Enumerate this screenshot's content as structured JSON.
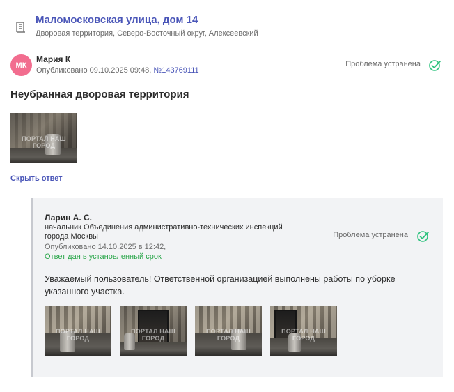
{
  "address": {
    "icon": "building-icon",
    "title": "Маломосковская улица, дом 14",
    "subtitle": "Дворовая территория, Северо-Восточный округ, Алексеевский"
  },
  "post": {
    "avatar_initials": "МК",
    "author": "Мария К",
    "published_prefix": "Опубликовано 09.10.2025 09:48, ",
    "number": "№143769111",
    "status": "Проблема устранена",
    "title": "Неубранная дворовая территория",
    "photo_watermark": "ПОРТАЛ НАШ ГОРОД"
  },
  "toggle_answer_label": "Скрыть ответ",
  "response": {
    "name": "Ларин А. С.",
    "position": "начальник Объединения административно-технических инспекций города Москвы",
    "published": "Опубликовано 14.10.2025 в 12:42,",
    "on_time": "Ответ дан в установленный срок",
    "status": "Проблема устранена",
    "text": "Уважаемый пользователь! Ответственной организацией выполнены работы по уборке указанного участка.",
    "photo_watermark": "ПОРТАЛ НАШ ГОРОД"
  },
  "colors": {
    "link": "#4a56b8",
    "success": "#2aa64a",
    "check": "#2ec27e",
    "avatar": "#f26d8f"
  }
}
